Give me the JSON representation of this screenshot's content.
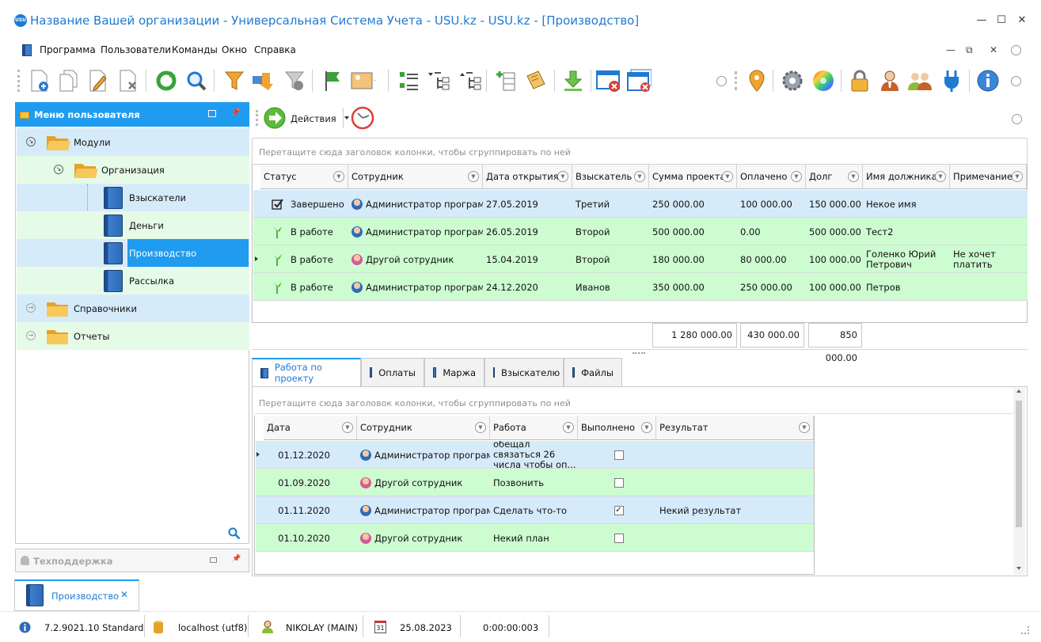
{
  "window": {
    "title": "Название Вашей организации - Универсальная Система Учета - USU.kz - USU.kz - [Производство]",
    "logo_text": "USU",
    "minimize": "—",
    "maximize": "☐",
    "close": "✕"
  },
  "menu": {
    "items": [
      "Программа",
      "Пользователи",
      "Команды",
      "Окно",
      "Справка"
    ],
    "mdi_min": "—",
    "mdi_restore": "⧉",
    "mdi_close": "✕"
  },
  "toolbar": {
    "left_icons": [
      "add-document-icon",
      "copy-document-icon",
      "edit-document-icon",
      "delete-document-icon",
      "refresh-icon",
      "search-icon",
      "filter-icon",
      "filter-settings-icon",
      "clear-filter-icon",
      "flag-icon",
      "image-icon",
      "expand-rows-icon",
      "tree-expand-icon",
      "tree-collapse-icon",
      "add-row-icon",
      "notes-icon",
      "download-icon",
      "close-window-icon",
      "close-all-windows-icon"
    ],
    "right_icons": [
      "location-pin-icon",
      "gear-icon",
      "color-wheel-icon",
      "lock-icon",
      "user-icon",
      "users-icon",
      "plugin-icon",
      "info-icon"
    ]
  },
  "user_menu": {
    "title": "Меню пользователя",
    "tree": [
      {
        "label": "Модули",
        "level": 0,
        "type": "folder-open"
      },
      {
        "label": "Организация",
        "level": 1,
        "type": "folder-open"
      },
      {
        "label": "Взыскатели",
        "level": 2,
        "type": "book"
      },
      {
        "label": "Деньги",
        "level": 2,
        "type": "book"
      },
      {
        "label": "Производство",
        "level": 2,
        "type": "book",
        "selected": true
      },
      {
        "label": "Рассылка",
        "level": 2,
        "type": "book"
      },
      {
        "label": "Справочники",
        "level": 0,
        "type": "folder"
      },
      {
        "label": "Отчеты",
        "level": 0,
        "type": "folder"
      }
    ],
    "support_title": "Техподдержка"
  },
  "actions": {
    "label": "Действия"
  },
  "main_grid": {
    "group_hint": "Перетащите сюда заголовок колонки, чтобы сгруппировать по ней",
    "columns": [
      "Статус",
      "Сотрудник",
      "Дата открытия",
      "Взыскатель",
      "Сумма проекта",
      "Оплачено",
      "Долг",
      "Имя должника",
      "Примечание"
    ],
    "rows": [
      {
        "status": "Завершено",
        "status_icon": "check-icon",
        "employee": "Администратор программы",
        "date": "27.05.2019",
        "creditor": "Третий",
        "amount": "250 000.00",
        "paid": "100 000.00",
        "debt": "150 000.00",
        "debtor": "Некое имя",
        "note": ""
      },
      {
        "status": "В работе",
        "status_icon": "flag-icon",
        "employee": "Администратор программы",
        "date": "26.05.2019",
        "creditor": "Второй",
        "amount": "500 000.00",
        "paid": "0.00",
        "debt": "500 000.00",
        "debtor": "Тест2",
        "note": ""
      },
      {
        "status": "В работе",
        "status_icon": "flag-icon",
        "employee": "Другой сотрудник",
        "date": "15.04.2019",
        "creditor": "Второй",
        "amount": "180 000.00",
        "paid": "80 000.00",
        "debt": "100 000.00",
        "debtor": "Голенко Юрий Петрович",
        "note": "Не хочет платить"
      },
      {
        "status": "В работе",
        "status_icon": "flag-icon",
        "employee": "Администратор программы",
        "date": "24.12.2020",
        "creditor": "Иванов",
        "amount": "350 000.00",
        "paid": "250 000.00",
        "debt": "100 000.00",
        "debtor": "Петров",
        "note": ""
      }
    ],
    "totals": {
      "amount": "1 280 000.00",
      "paid": "430 000.00",
      "debt": "850 000.00"
    }
  },
  "tabs": [
    "Работа по проекту",
    "Оплаты",
    "Маржа",
    "Взыскателю",
    "Файлы"
  ],
  "sub_grid": {
    "group_hint": "Перетащите сюда заголовок колонки, чтобы сгруппировать по ней",
    "columns": [
      "Дата",
      "Сотрудник",
      "Работа",
      "Выполнено",
      "Результат"
    ],
    "rows": [
      {
        "date": "01.12.2020",
        "employee": "Администратор программы",
        "work": "обещал связаться 26 числа чтобы оп...",
        "done": false,
        "result": ""
      },
      {
        "date": "01.09.2020",
        "employee": "Другой сотрудник",
        "work": "Позвонить",
        "done": false,
        "result": ""
      },
      {
        "date": "01.11.2020",
        "employee": "Администратор программы",
        "work": "Сделать что-то",
        "done": true,
        "result": "Некий результат"
      },
      {
        "date": "01.10.2020",
        "employee": "Другой сотрудник",
        "work": "Некий план",
        "done": false,
        "result": ""
      }
    ]
  },
  "doc_tab": {
    "label": "Производство",
    "close": "✕"
  },
  "status": {
    "version": "7.2.9021.10 Standard",
    "db": "localhost (utf8)",
    "user": "NIKOLAY (MAIN)",
    "calendar_day": "31",
    "date": "25.08.2023",
    "timer": "0:00:00:003"
  },
  "colors": {
    "accent": "#1f9bf0",
    "row_blue": "#d6ebf9",
    "row_green": "#cdfcd1",
    "title_blue": "#1f7ad1"
  }
}
